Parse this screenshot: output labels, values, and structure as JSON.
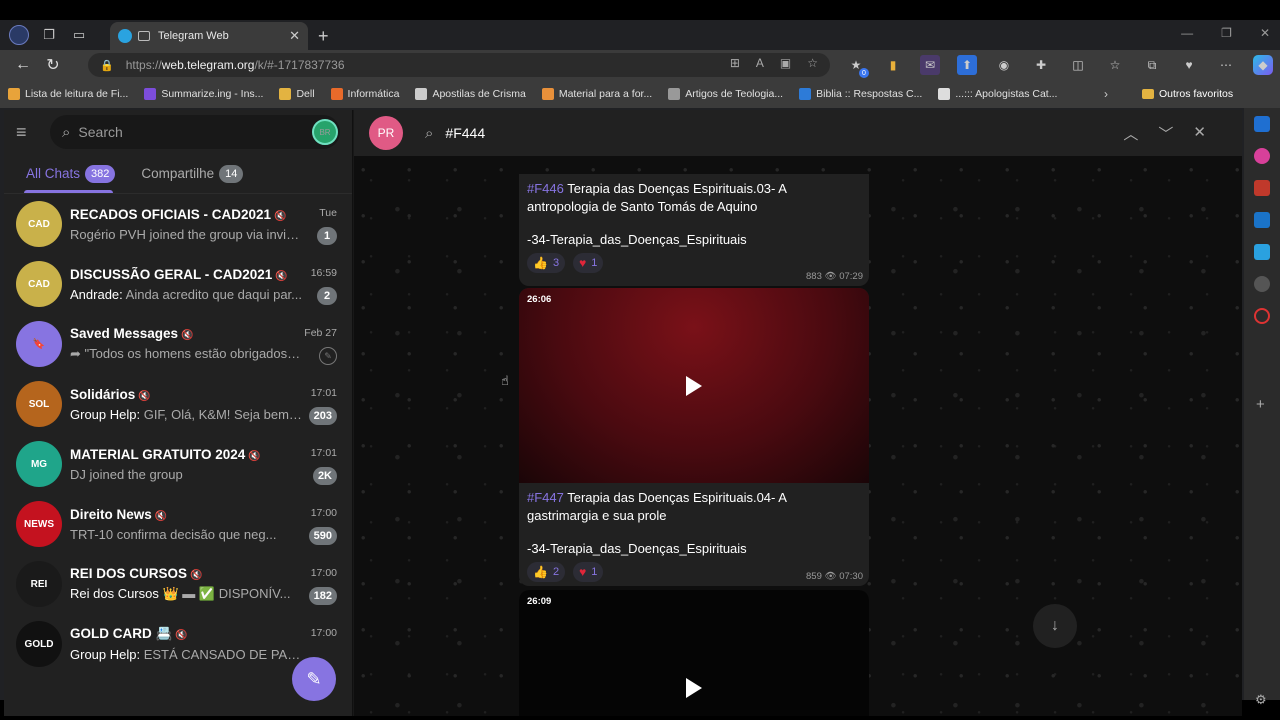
{
  "browser": {
    "tab_title": "Telegram Web",
    "url_prefix": "https://",
    "url_host": "web.telegram.org",
    "url_rest": "/k/#-1717837736",
    "extension_badge": "0",
    "window_controls": [
      "—",
      "❐",
      "✕"
    ]
  },
  "bookmarks": [
    {
      "label": "Lista de leitura de Fi...",
      "color": "#e8a33a"
    },
    {
      "label": "Summarize.ing - Ins...",
      "color": "#7c4ddb"
    },
    {
      "label": "Dell",
      "color": "#e3b341"
    },
    {
      "label": "Informática",
      "color": "#e86a2a"
    },
    {
      "label": "Apostilas de Crisma",
      "color": "#cccccc"
    },
    {
      "label": "Material para a for...",
      "color": "#e8903a"
    },
    {
      "label": "Artigos de Teologia...",
      "color": "#999999"
    },
    {
      "label": "Biblia :: Respostas C...",
      "color": "#2d7bd8"
    },
    {
      "label": "...::: Apologistas Cat...",
      "color": "#dddddd"
    }
  ],
  "bookmarks_other": "Outros favoritos",
  "sidebar": {
    "search_placeholder": "Search",
    "profile_initials": "BR",
    "tabs": [
      {
        "label": "All Chats",
        "count": "382"
      },
      {
        "label": "Compartilhe",
        "count": "14"
      }
    ],
    "chats": [
      {
        "title": "RECADOS OFICIAIS - CAD2021",
        "sender": "",
        "preview": "Rogério PVH joined the group via invite...",
        "time": "Tue",
        "badge": "1",
        "avatar_color": "#c9b14a",
        "avatar_text": "CAD"
      },
      {
        "title": "DISCUSSÃO GERAL - CAD2021",
        "sender": "Andrade: ",
        "preview": "Ainda acredito que daqui par...",
        "time": "16:59",
        "badge": "2",
        "avatar_color": "#c9b14a",
        "avatar_text": "CAD"
      },
      {
        "title": "Saved Messages",
        "sender": "",
        "preview": "➦ \"Todos os homens estão obrigados a...",
        "time": "Feb 27",
        "badge": "",
        "avatar_color": "#8774e1",
        "avatar_text": "🔖"
      },
      {
        "title": "Solidários",
        "sender": "Group Help: ",
        "preview": "GIF, Olá, K&M! Seja bem ...",
        "time": "17:01",
        "badge": "203",
        "avatar_color": "#b5651d",
        "avatar_text": "SOL"
      },
      {
        "title": "MATERIAL GRATUITO 2024",
        "sender": "",
        "preview": "DJ joined the group",
        "time": "17:01",
        "badge": "2K",
        "avatar_color": "#1fa58a",
        "avatar_text": "MG"
      },
      {
        "title": "Direito News",
        "sender": "",
        "preview": "TRT-10 confirma decisão que neg...",
        "time": "17:00",
        "badge": "590",
        "avatar_color": "#c4121f",
        "avatar_text": "NEWS"
      },
      {
        "title": "REI DOS CURSOS",
        "sender": "Rei dos Cursos ",
        "preview": "👑 ▬ ✅ DISPONÍV...",
        "time": "17:00",
        "badge": "182",
        "avatar_color": "#1a1a1a",
        "avatar_text": "REI"
      },
      {
        "title": "GOLD CARD 📇",
        "sender": "Group Help: ",
        "preview": "ESTÁ CANSADO DE PAGA...",
        "time": "17:00",
        "badge": "",
        "avatar_color": "#111111",
        "avatar_text": "GOLD"
      }
    ]
  },
  "chat_header": {
    "peer_initials": "PR",
    "search_query": "#F444"
  },
  "messages": [
    {
      "hashtag": "#F446",
      "title": " Terapia das Doenças Espirituais.03- A antropologia de Santo Tomás de Aquino",
      "tag": "-34-Terapia_das_Doenças_Espirituais",
      "likes": "3",
      "hearts": "1",
      "views": "883",
      "time": "07:29"
    },
    {
      "duration": "26:06",
      "hashtag": "#F447",
      "title": " Terapia das Doenças Espirituais.04- A gastrimargia e sua prole",
      "tag": "-34-Terapia_das_Doenças_Espirituais",
      "likes": "2",
      "hearts": "1",
      "views": "859",
      "time": "07:30"
    },
    {
      "duration": "26:09"
    }
  ]
}
